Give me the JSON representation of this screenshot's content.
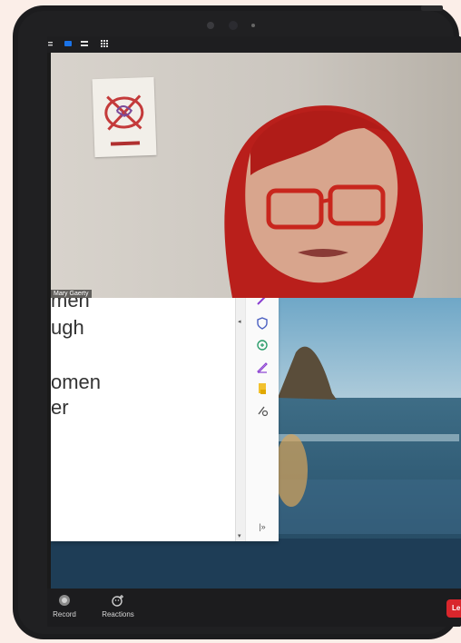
{
  "meeting": {
    "participant_name": "Mary Gaerty"
  },
  "shared_document": {
    "lines": [
      "men",
      "ugh",
      "omen",
      "er"
    ]
  },
  "bottom_toolbar": {
    "record_label": "Record",
    "reactions_label": "Reactions",
    "leave_label": "Le"
  },
  "colors": {
    "leave_red": "#d9262c",
    "toolbar_dark": "#1c1c1e",
    "view_icon_blue": "#1a73e8"
  },
  "icons": {
    "top_toolbar": [
      "view-toggle-icon",
      "speaker-view-icon",
      "list-view-icon",
      "gallery-view-icon"
    ],
    "side_tools": [
      "pen-icon",
      "shield-icon",
      "share-icon",
      "sign-icon",
      "document-icon",
      "tools-icon"
    ]
  }
}
